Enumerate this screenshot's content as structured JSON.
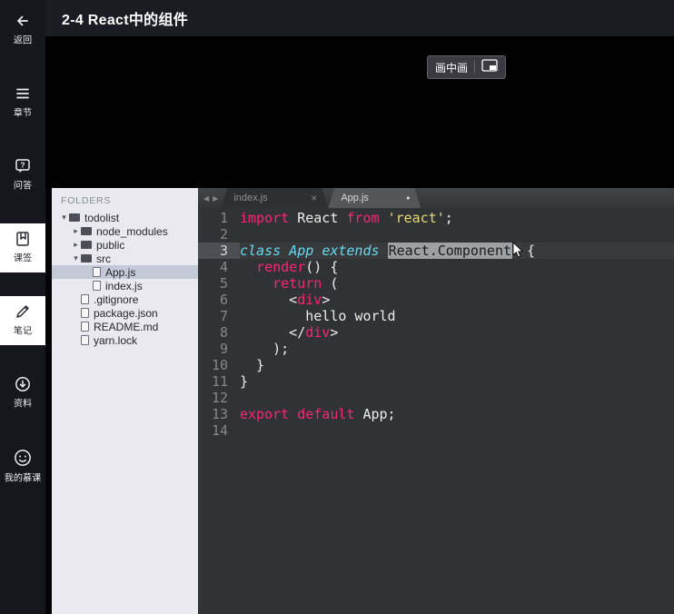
{
  "header": {
    "title": "2-4 React中的组件"
  },
  "sidebar": {
    "items": [
      {
        "label": "返回",
        "icon": "back-arrow-icon",
        "active": false
      },
      {
        "label": "章节",
        "icon": "chapter-list-icon",
        "active": false
      },
      {
        "label": "问答",
        "icon": "qa-bubble-icon",
        "active": false
      },
      {
        "label": "课签",
        "icon": "bookmark-icon",
        "active": true
      },
      {
        "label": "笔记",
        "icon": "pencil-icon",
        "active": true
      },
      {
        "label": "资料",
        "icon": "download-icon",
        "active": false
      },
      {
        "label": "我的慕课",
        "icon": "avatar-icon",
        "active": false
      }
    ]
  },
  "video": {
    "pip_label": "画中画",
    "pip_icon": "picture-in-picture-icon"
  },
  "explorer": {
    "header": "FOLDERS",
    "items": [
      {
        "label": "todolist",
        "type": "folder",
        "level": 0,
        "state": "expanded",
        "selected": false
      },
      {
        "label": "node_modules",
        "type": "folder",
        "level": 1,
        "state": "collapsed",
        "selected": false
      },
      {
        "label": "public",
        "type": "folder",
        "level": 1,
        "state": "collapsed",
        "selected": false
      },
      {
        "label": "src",
        "type": "folder",
        "level": 1,
        "state": "expanded",
        "selected": false
      },
      {
        "label": "App.js",
        "type": "file",
        "level": 2,
        "selected": true
      },
      {
        "label": "index.js",
        "type": "file",
        "level": 2,
        "selected": false
      },
      {
        "label": ".gitignore",
        "type": "file",
        "level": 1,
        "selected": false
      },
      {
        "label": "package.json",
        "type": "file",
        "level": 1,
        "selected": false
      },
      {
        "label": "README.md",
        "type": "file",
        "level": 1,
        "selected": false
      },
      {
        "label": "yarn.lock",
        "type": "file",
        "level": 1,
        "selected": false
      }
    ]
  },
  "editor": {
    "nav_left": "◀",
    "nav_right": "▶",
    "tabs": [
      {
        "label": "index.js",
        "active": false,
        "close": "×"
      },
      {
        "label": "App.js",
        "active": true,
        "dot": "●"
      }
    ],
    "colors": {
      "keyword": "#f92672",
      "string": "#e6db74",
      "class": "#66d9ef",
      "plain": "#eeeeec",
      "background": "#303234"
    },
    "lines": [
      {
        "num": "1",
        "tokens": [
          {
            "c": "kw",
            "t": "import"
          },
          {
            "c": "pl",
            "t": " React "
          },
          {
            "c": "kw",
            "t": "from"
          },
          {
            "c": "pl",
            "t": " "
          },
          {
            "c": "str",
            "t": "'react'"
          },
          {
            "c": "pl",
            "t": ";"
          }
        ]
      },
      {
        "num": "2",
        "tokens": []
      },
      {
        "num": "3",
        "current": true,
        "tokens": [
          {
            "c": "cls",
            "t": "class"
          },
          {
            "c": "pl",
            "t": " "
          },
          {
            "c": "cls",
            "t": "App"
          },
          {
            "c": "pl",
            "t": " "
          },
          {
            "c": "cls",
            "t": "extends"
          },
          {
            "c": "pl",
            "t": " "
          },
          {
            "c": "sel",
            "t": "React.Component",
            "cursor": true
          },
          {
            "c": "pl",
            "t": " {"
          }
        ]
      },
      {
        "num": "4",
        "tokens": [
          {
            "c": "pl",
            "t": "  "
          },
          {
            "c": "kw",
            "t": "render"
          },
          {
            "c": "pl",
            "t": "() {"
          }
        ]
      },
      {
        "num": "5",
        "tokens": [
          {
            "c": "pl",
            "t": "    "
          },
          {
            "c": "kw",
            "t": "return"
          },
          {
            "c": "pl",
            "t": " ("
          }
        ]
      },
      {
        "num": "6",
        "tokens": [
          {
            "c": "pl",
            "t": "      <"
          },
          {
            "c": "tag",
            "t": "div"
          },
          {
            "c": "pl",
            "t": ">"
          }
        ]
      },
      {
        "num": "7",
        "tokens": [
          {
            "c": "pl",
            "t": "        hello world"
          }
        ]
      },
      {
        "num": "8",
        "tokens": [
          {
            "c": "pl",
            "t": "      </"
          },
          {
            "c": "tag",
            "t": "div"
          },
          {
            "c": "pl",
            "t": ">"
          }
        ]
      },
      {
        "num": "9",
        "tokens": [
          {
            "c": "pl",
            "t": "    );"
          }
        ]
      },
      {
        "num": "10",
        "tokens": [
          {
            "c": "pl",
            "t": "  }"
          }
        ]
      },
      {
        "num": "11",
        "tokens": [
          {
            "c": "pl",
            "t": "}"
          }
        ]
      },
      {
        "num": "12",
        "tokens": []
      },
      {
        "num": "13",
        "tokens": [
          {
            "c": "kw",
            "t": "export"
          },
          {
            "c": "pl",
            "t": " "
          },
          {
            "c": "kw",
            "t": "default"
          },
          {
            "c": "pl",
            "t": " App;"
          }
        ]
      },
      {
        "num": "14",
        "tokens": []
      }
    ]
  }
}
